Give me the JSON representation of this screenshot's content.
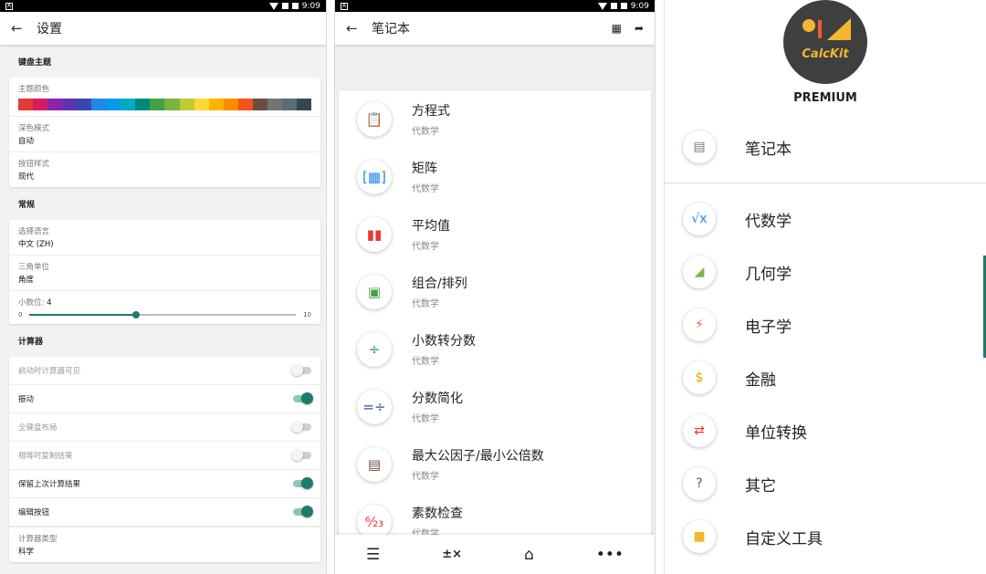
{
  "status_time": "9:09",
  "settings": {
    "title": "设置",
    "sections": {
      "keyboard_theme": "键盘主题",
      "general": "常规",
      "calculator": "计算器"
    },
    "theme_color_label": "主题颜色",
    "theme_colors": [
      "#e53935",
      "#d81b60",
      "#8e24aa",
      "#5e35b1",
      "#3949ab",
      "#1e88e5",
      "#039be5",
      "#00acc1",
      "#00897b",
      "#43a047",
      "#7cb342",
      "#c0ca33",
      "#fdd835",
      "#ffb300",
      "#fb8c00",
      "#f4511e",
      "#6d4c41",
      "#757575",
      "#546e7a",
      "#37474f"
    ],
    "dark_mode": {
      "label": "深色模式",
      "value": "自动"
    },
    "button_style": {
      "label": "按钮样式",
      "value": "现代"
    },
    "language": {
      "label": "选择语言",
      "value": "中文 (ZH)"
    },
    "angle_unit": {
      "label": "三角单位",
      "value": "角度"
    },
    "decimals": {
      "label": "小数位:",
      "value": "4",
      "min": "0",
      "max": "10",
      "fraction": 0.4
    },
    "toggles": [
      {
        "label": "启动时计算器可见",
        "on": false,
        "dim": true
      },
      {
        "label": "振动",
        "on": true,
        "dim": false
      },
      {
        "label": "全键盘布局",
        "on": false,
        "dim": true
      },
      {
        "label": "相等时复制结果",
        "on": false,
        "dim": true
      },
      {
        "label": "保留上次计算结果",
        "on": true,
        "dim": false
      },
      {
        "label": "编辑按钮",
        "on": true,
        "dim": false
      }
    ],
    "calc_type": {
      "label": "计算器类型",
      "value": "科学"
    }
  },
  "notebook": {
    "title": "笔记本",
    "items": [
      {
        "title": "方程式",
        "sub": "代数学",
        "icon": "clipboard-icon"
      },
      {
        "title": "矩阵",
        "sub": "代数学",
        "icon": "matrix-icon"
      },
      {
        "title": "平均值",
        "sub": "代数学",
        "icon": "bar-chart-icon"
      },
      {
        "title": "组合/排列",
        "sub": "代数学",
        "icon": "blocks-icon"
      },
      {
        "title": "小数转分数",
        "sub": "代数学",
        "icon": "divide-icon"
      },
      {
        "title": "分数简化",
        "sub": "代数学",
        "icon": "fraction-icon"
      },
      {
        "title": "最大公因子/最小公倍数",
        "sub": "代数学",
        "icon": "grid-icon"
      },
      {
        "title": "素数检查",
        "sub": "代数学",
        "icon": "prime-tree-icon"
      }
    ]
  },
  "drawer": {
    "logo_text": "CalcKit",
    "badge": "PREMIUM",
    "items": [
      {
        "label": "笔记本",
        "icon": "notebook-icon"
      },
      {
        "label": "代数学",
        "icon": "sqrt-icon"
      },
      {
        "label": "几何学",
        "icon": "triangle-icon"
      },
      {
        "label": "电子学",
        "icon": "resistor-icon"
      },
      {
        "label": "金融",
        "icon": "money-bag-icon"
      },
      {
        "label": "单位转换",
        "icon": "convert-icon"
      },
      {
        "label": "其它",
        "icon": "question-icon"
      },
      {
        "label": "自定义工具",
        "icon": "folder-icon"
      }
    ]
  }
}
